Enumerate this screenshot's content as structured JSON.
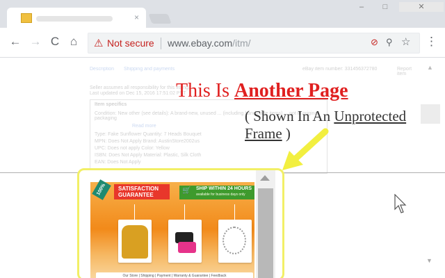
{
  "browser": {
    "tab": {
      "title": "",
      "close_label": "×"
    },
    "window_buttons": {
      "minimize": "–",
      "maximize": "□",
      "close": "✕"
    },
    "nav": {
      "back": "←",
      "forward": "→",
      "reload": "C",
      "home": "⌂",
      "menu": "⋮"
    },
    "omnibox": {
      "security_label": "Not secure",
      "url_host": "www.ebay.com",
      "url_path": "/itm/",
      "warn_icon": "⚠",
      "translate_icon": "⊘",
      "zoom_icon": "⚲",
      "star_icon": "☆"
    }
  },
  "ebay": {
    "tabs": [
      "Description",
      "Shipping and payments"
    ],
    "item_number": "eBay item number: 331456372780",
    "report": "Report item",
    "seller_line": "Seller assumes all responsibility for this listing.",
    "updated_line": "Last updated on Dec 15, 2016 17:51:02 PST",
    "specs_title": "Item specifics",
    "spec_rows": [
      "Condition:   New other (see details): A brand-new, unused ... (including handmade items) ... not in original packaging",
      "Read more",
      "Type:   Fake Sunflower            Quantity:  7 Heads Bouquet",
      "MPN:   Does Not Apply            Brand:  AustinStore2002us",
      "UPC:   Does not apply            Color:  Yellow",
      "ISBN:   Does Not Apply            Material:  Plastic, Silk Cloth",
      "EAN:   Does Not Apply"
    ],
    "scroll_up": "▲",
    "scroll_down": "▼"
  },
  "overlay": {
    "title_prefix": "This Is ",
    "title_underlined": "Another Page",
    "subtitle_open": "( Shown In An ",
    "subtitle_underlined": "Unprotected Frame",
    "subtitle_close": " )"
  },
  "ad": {
    "badge": "100%",
    "satisfaction": "SATISFACTION GUARANTEE",
    "ship_title": "SHIP WITHIN 24 HOURS",
    "ship_sub": "available for business days only",
    "footer": "Our Store | Shipping | Payment | Warranty & Guarantee | Feedback"
  },
  "colors": {
    "title_red": "#e02020",
    "frame_yellow": "#f2ef66",
    "ad_orange": "#f28a1a"
  }
}
